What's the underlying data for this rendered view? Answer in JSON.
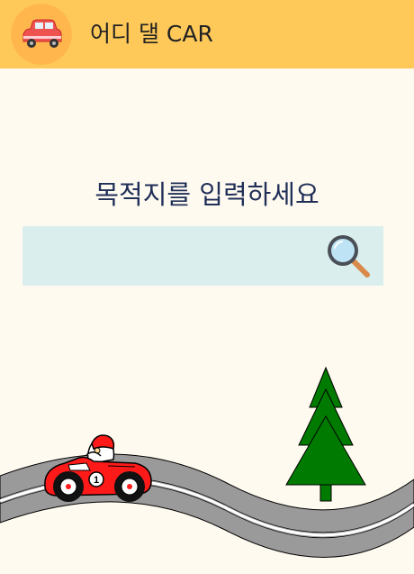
{
  "header": {
    "title": "어디 댈 CAR",
    "logo_icon": "car-logo-icon",
    "background": "#ffc95a"
  },
  "main": {
    "prompt": "목적지를 입력하세요",
    "search": {
      "value": "",
      "placeholder": "",
      "button_icon": "magnifier-icon"
    }
  },
  "scene": {
    "car_icon": "race-car-icon",
    "car_number": "1",
    "tree_icon": "pine-tree-icon",
    "road_color": "#999999",
    "tree_color": "#007a00",
    "car_color": "#ff1a1a"
  }
}
